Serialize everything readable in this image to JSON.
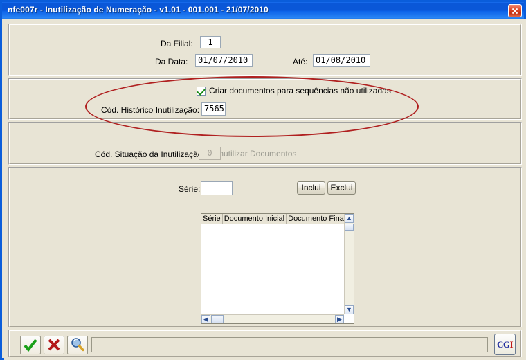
{
  "window": {
    "title": "nfe007r - Inutilização de Numeração - v1.01 - 001.001 - 21/07/2010",
    "close_label": "",
    "accent_titlebar": "#0a57d8",
    "background": "#e8e4d5"
  },
  "filter_panel": {
    "filial_label": "Da Filial:",
    "filial_value": "1",
    "data_label": "Da Data:",
    "data_value": "01/07/2010",
    "ate_label": "Até:",
    "ate_value": "01/08/2010"
  },
  "create_panel": {
    "checkbox_label": "Criar documentos para sequências não utilizadas",
    "checkbox_checked": true,
    "historico_label": "Cód. Histórico Inutilização:",
    "historico_value": "7565"
  },
  "inutilizar_panel": {
    "checkbox_label": "Inutilizar Documentos",
    "checkbox_checked": false,
    "disabled": true,
    "situacao_label": "Cód. Situação da Inutilização:",
    "situacao_value": "0"
  },
  "serie_panel": {
    "serie_label": "Série:",
    "serie_value": "",
    "inclui_label": "Inclui",
    "exclui_label": "Exclui",
    "columns": [
      "Série",
      "Documento Inicial",
      "Documento Final"
    ],
    "rows": []
  },
  "toolbar": {
    "confirm_icon": "check-icon",
    "cancel_icon": "cross-icon",
    "search_icon": "magnifier-icon",
    "status_value": "",
    "logo_blue": "CG",
    "logo_red": "I"
  },
  "annotation": {
    "shape": "ellipse",
    "color": "#b02020"
  }
}
